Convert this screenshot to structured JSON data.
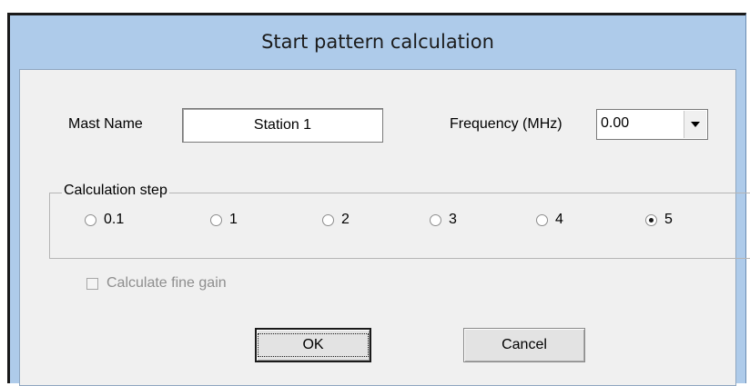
{
  "window": {
    "title": "Start pattern calculation"
  },
  "mast": {
    "label": "Mast Name",
    "value": "Station 1"
  },
  "frequency": {
    "label": "Frequency (MHz)",
    "value": "0.00"
  },
  "calc_step": {
    "title": "Calculation step",
    "options": [
      "0.1",
      "1",
      "2",
      "3",
      "4",
      "5"
    ],
    "selected": "5"
  },
  "fine_gain": {
    "label": "Calculate fine gain",
    "checked": false,
    "enabled": false
  },
  "buttons": {
    "ok": "OK",
    "cancel": "Cancel"
  },
  "icons": {
    "combo_arrow": "chevron-down-icon"
  }
}
